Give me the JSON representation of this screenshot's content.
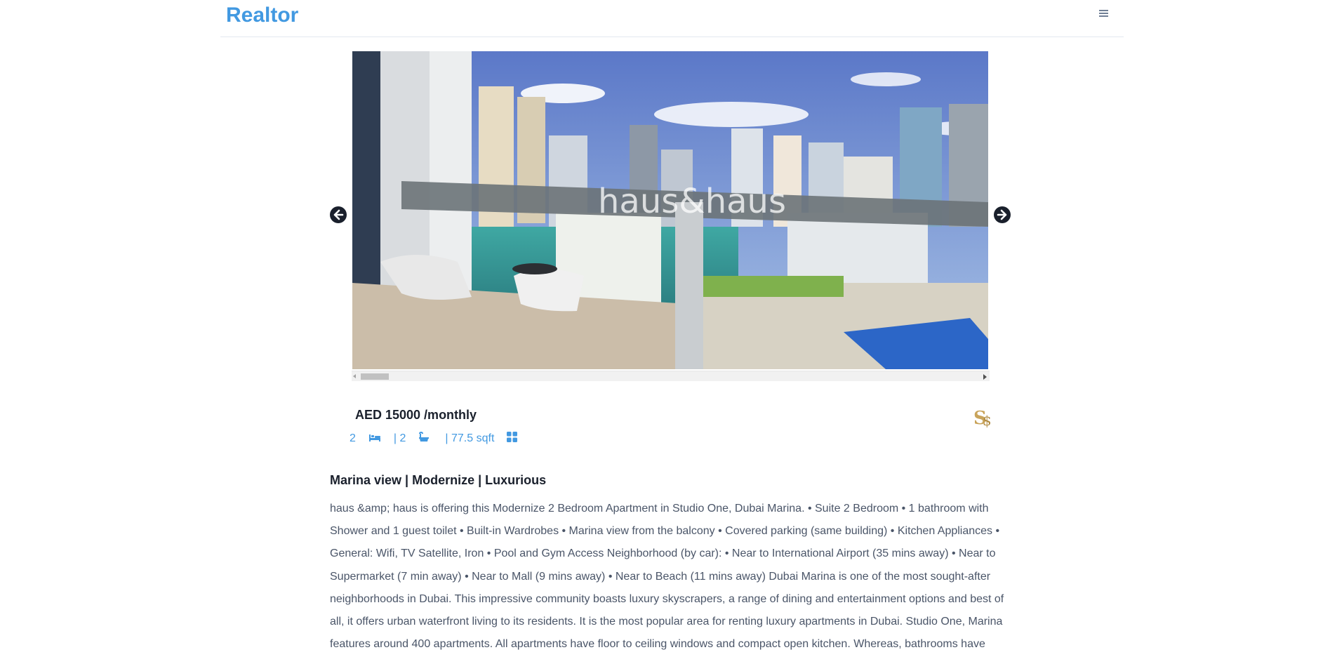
{
  "brand": "Realtor",
  "carousel": {
    "watermark": "haus&haus"
  },
  "listing": {
    "price": "AED 15000 /monthly",
    "bedrooms": "2",
    "bathrooms": "| 2",
    "area": "| 77.5 sqft",
    "title": "Marina view | Modernize | Luxurious",
    "description": "haus &amp; haus is offering this Modernize 2 Bedroom Apartment in Studio One, Dubai Marina. • Suite 2 Bedroom • 1 bathroom with Shower and 1 guest toilet • Built-in Wardrobes • Marina view from the balcony • Covered parking (same building) • Kitchen Appliances • General: Wifi, TV Satellite, Iron • Pool and Gym Access Neighborhood (by car): • Near to International Airport (35 mins away) • Near to Supermarket (7 min away) • Near to Mall (9 mins away) • Near to Beach (11 mins away) Dubai Marina is one of the most sought-after neighborhoods in Dubai. This impressive community boasts luxury skyscrapers, a range of dining and entertainment options and best of all, it offers urban waterfront living to its residents. It is the most popular area for renting luxury apartments in Dubai. Studio One, Marina features around 400 apartments. All apartments have floor to ceiling windows and compact open kitchen. Whereas, bathrooms have"
  },
  "icons": {
    "menu": "hamburger-icon",
    "prev": "arrow-left-circle-icon",
    "next": "arrow-right-circle-icon",
    "bed": "bed-icon",
    "bath": "bath-icon",
    "area": "grid-icon",
    "agent": "agent-logo"
  },
  "colors": {
    "accent": "#4299e1",
    "text": "#4a5568",
    "heading": "#1a202c"
  }
}
